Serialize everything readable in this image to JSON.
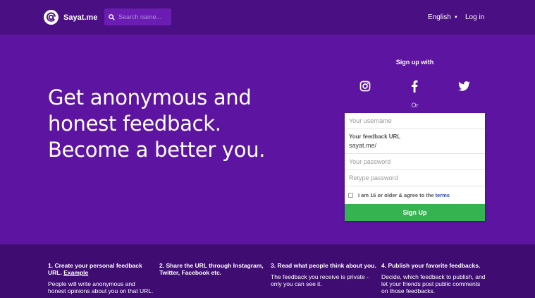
{
  "header": {
    "logo_text": "Sayat.me",
    "search_placeholder": "Search name...",
    "language": "English",
    "login_label": "Log in"
  },
  "hero": {
    "lines": [
      "Get anonymous and",
      "honest feedback.",
      "Become a better you."
    ]
  },
  "signup": {
    "heading": "Sign up with",
    "social": [
      "instagram-icon",
      "facebook-icon",
      "twitter-icon"
    ],
    "or_text": "Or",
    "username_placeholder": "Your username",
    "url_label": "Your feedback URL",
    "url_value": "sayat.me/",
    "password_placeholder": "Your password",
    "retype_placeholder": "Retype password",
    "agree_text": "I am 16 or older & agree to the",
    "terms_label": "terms",
    "button_label": "Sign Up"
  },
  "steps": [
    {
      "title": "1. Create your personal feedback URL.",
      "link": "Example",
      "body": "People will write anonymous and honest opinions about you on that URL."
    },
    {
      "title": "2. Share the URL through Instagram, Twitter, Facebook etc.",
      "link": "",
      "body": ""
    },
    {
      "title": "3. Read what people think about you.",
      "link": "",
      "body": "The feedback you receive is private - only you can see it."
    },
    {
      "title": "4. Publish your favorite feedbacks.",
      "link": "",
      "body": "Decide, which feedback to publish, and let your friends post public comments on those feedbacks."
    }
  ],
  "colors": {
    "background": "#5d14a0",
    "header": "#4a0f82",
    "steps_band": "#3f0c72",
    "signup_button": "#34b350",
    "terms_link": "#2c49a8"
  }
}
